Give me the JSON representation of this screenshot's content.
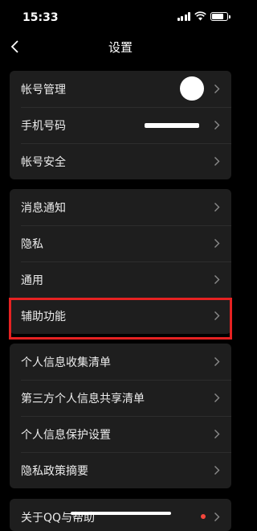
{
  "status_bar": {
    "time": "15:33"
  },
  "nav": {
    "title": "设置"
  },
  "groups": [
    {
      "items": [
        {
          "label": "帐号管理"
        },
        {
          "label": "手机号码"
        },
        {
          "label": "帐号安全"
        }
      ]
    },
    {
      "items": [
        {
          "label": "消息通知"
        },
        {
          "label": "隐私"
        },
        {
          "label": "通用"
        },
        {
          "label": "辅助功能"
        }
      ]
    },
    {
      "items": [
        {
          "label": "个人信息收集清单"
        },
        {
          "label": "第三方个人信息共享清单"
        },
        {
          "label": "个人信息保护设置"
        },
        {
          "label": "隐私政策摘要"
        }
      ]
    },
    {
      "items": [
        {
          "label": "关于QQ与帮助"
        }
      ]
    }
  ],
  "colors": {
    "highlight": "#e52222",
    "badge": "#f5463c"
  }
}
